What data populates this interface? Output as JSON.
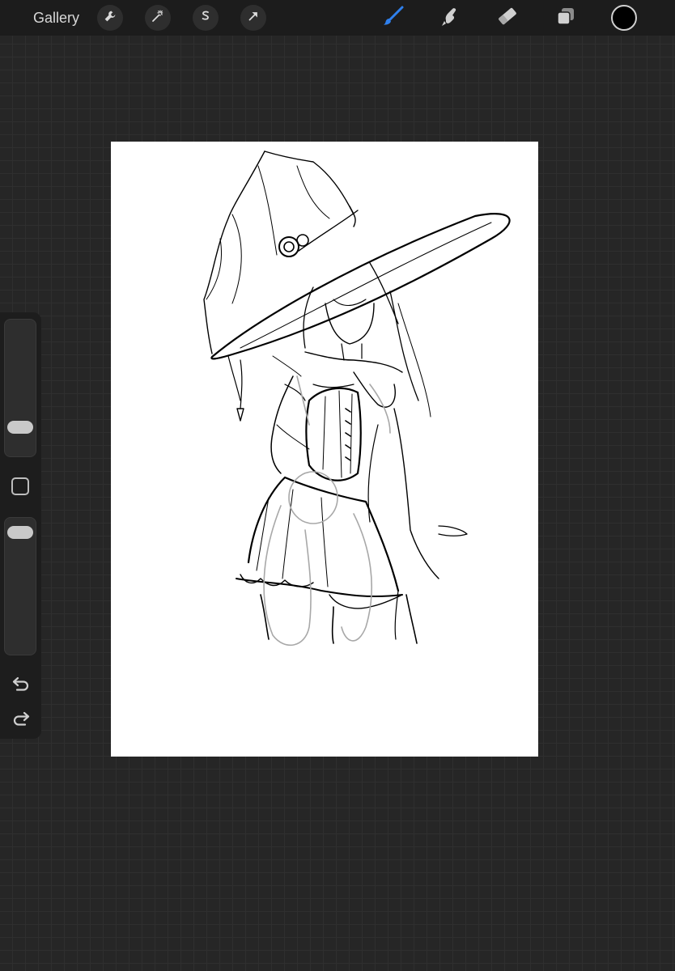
{
  "app": {
    "gallery_label": "Gallery"
  },
  "toolbar": {
    "left_tools": [
      {
        "name": "adjust",
        "icon": "wrench-icon"
      },
      {
        "name": "adjustments",
        "icon": "magic-wand-icon"
      },
      {
        "name": "selection",
        "icon": "selection-s-icon"
      },
      {
        "name": "transform",
        "icon": "arrow-cursor-icon"
      }
    ],
    "right_tools": [
      {
        "name": "brush",
        "icon": "brush-icon",
        "active": true
      },
      {
        "name": "smudge",
        "icon": "smudge-icon",
        "active": false
      },
      {
        "name": "eraser",
        "icon": "eraser-icon",
        "active": false
      },
      {
        "name": "layers",
        "icon": "layers-icon",
        "active": false
      }
    ],
    "current_color": "#000000",
    "accent_color": "#2f80ed"
  },
  "sidebar": {
    "brush_size_level": 0.17,
    "opacity_level": 0.95
  }
}
